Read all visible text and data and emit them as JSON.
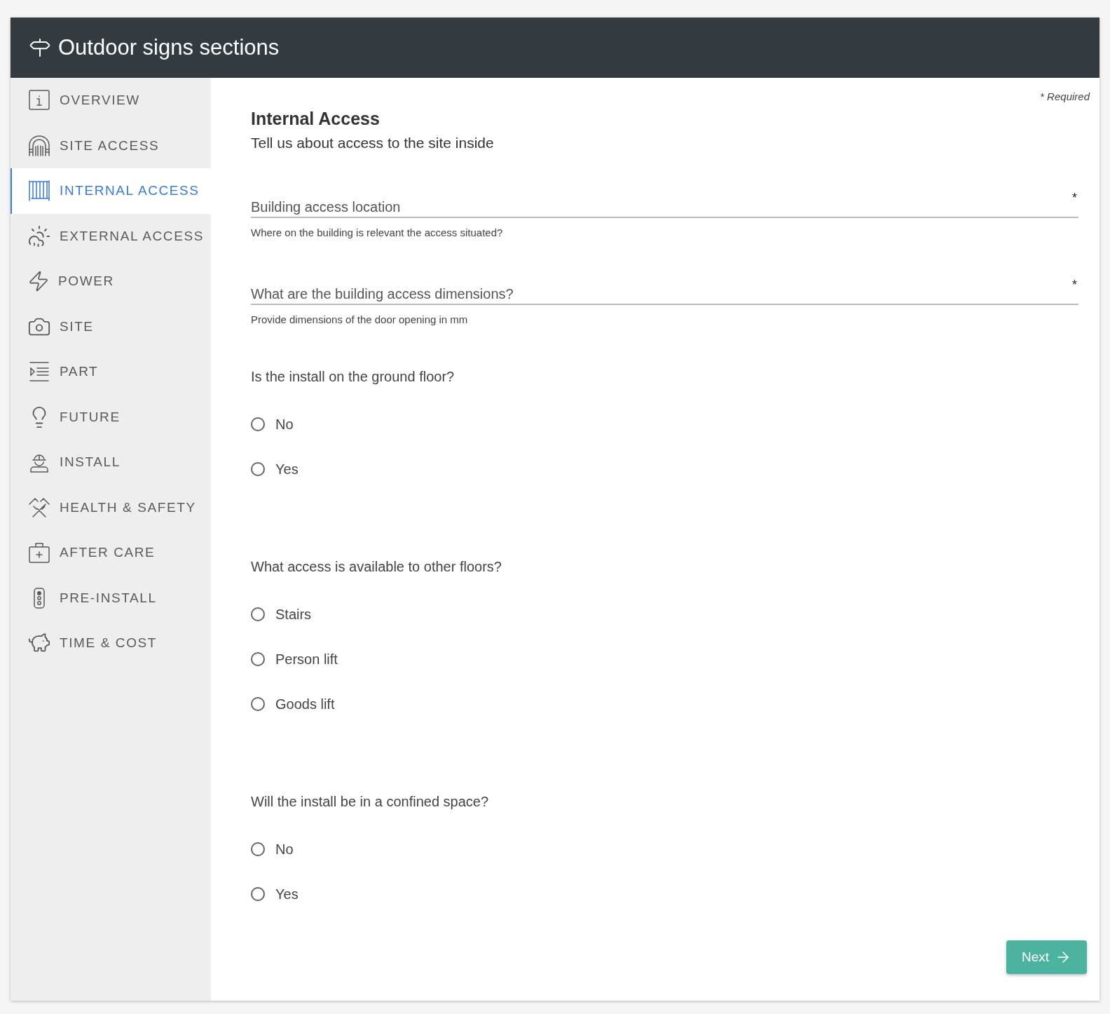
{
  "header": {
    "title": "Outdoor signs sections"
  },
  "sidebar": {
    "items": [
      {
        "label": "OVERVIEW",
        "selected": false
      },
      {
        "label": "SITE ACCESS",
        "selected": false
      },
      {
        "label": "INTERNAL ACCESS",
        "selected": true
      },
      {
        "label": "EXTERNAL ACCESS",
        "selected": false
      },
      {
        "label": "POWER",
        "selected": false
      },
      {
        "label": "SITE",
        "selected": false
      },
      {
        "label": "PART",
        "selected": false
      },
      {
        "label": "FUTURE",
        "selected": false
      },
      {
        "label": "INSTALL",
        "selected": false
      },
      {
        "label": "HEALTH & SAFETY",
        "selected": false
      },
      {
        "label": "AFTER CARE",
        "selected": false
      },
      {
        "label": "PRE-INSTALL",
        "selected": false
      },
      {
        "label": "TIME & COST",
        "selected": false
      }
    ]
  },
  "form": {
    "required_note": "* Required",
    "title": "Internal Access",
    "subtitle": "Tell us about access to the site inside",
    "fields": [
      {
        "placeholder": "Building access location",
        "required_mark": "*",
        "hint": "Where on the building is relevant the access situated?"
      },
      {
        "placeholder": "What are the building access dimensions?",
        "required_mark": "*",
        "hint": "Provide dimensions of the door opening in mm"
      }
    ],
    "questions": [
      {
        "label": "Is the install on the ground floor?",
        "options": [
          {
            "label": "No",
            "selected": false
          },
          {
            "label": "Yes",
            "selected": false
          }
        ]
      },
      {
        "label": "What access is available to other floors?",
        "options": [
          {
            "label": "Stairs",
            "selected": false
          },
          {
            "label": "Person lift",
            "selected": false
          },
          {
            "label": "Goods lift",
            "selected": false
          }
        ]
      },
      {
        "label": "Will the install be in a confined space?",
        "options": [
          {
            "label": "No",
            "selected": false
          },
          {
            "label": "Yes",
            "selected": false
          }
        ]
      }
    ]
  },
  "next_button": {
    "label": "Next"
  }
}
